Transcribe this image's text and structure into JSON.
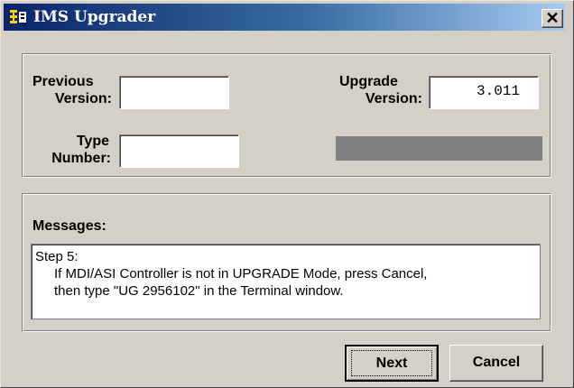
{
  "window": {
    "title": "IMS Upgrader",
    "close_glyph": "✕"
  },
  "icons": {
    "app": "ims-app-icon",
    "close": "close-icon"
  },
  "version_panel": {
    "previous_version": {
      "label_line1": "Previous",
      "label_line2": "Version:",
      "value": ""
    },
    "type_number": {
      "label_line1": "Type",
      "label_line2": "Number:",
      "value": ""
    },
    "upgrade_version": {
      "label_line1": "Upgrade",
      "label_line2": "Version:",
      "value": "3.011"
    },
    "progress": {
      "value_percent": 0
    }
  },
  "messages": {
    "title": "Messages:",
    "lines": [
      "Step 5:",
      "If MDI/ASI Controller is not in UPGRADE Mode, press Cancel,",
      "then type \"UG 2956102\" in the Terminal window."
    ]
  },
  "buttons": {
    "next": "Next",
    "cancel": "Cancel"
  },
  "colors": {
    "titlebar_start": "#0a246a",
    "titlebar_end": "#a6caf0",
    "face": "#d4d0c8",
    "progress_track": "#808080"
  }
}
